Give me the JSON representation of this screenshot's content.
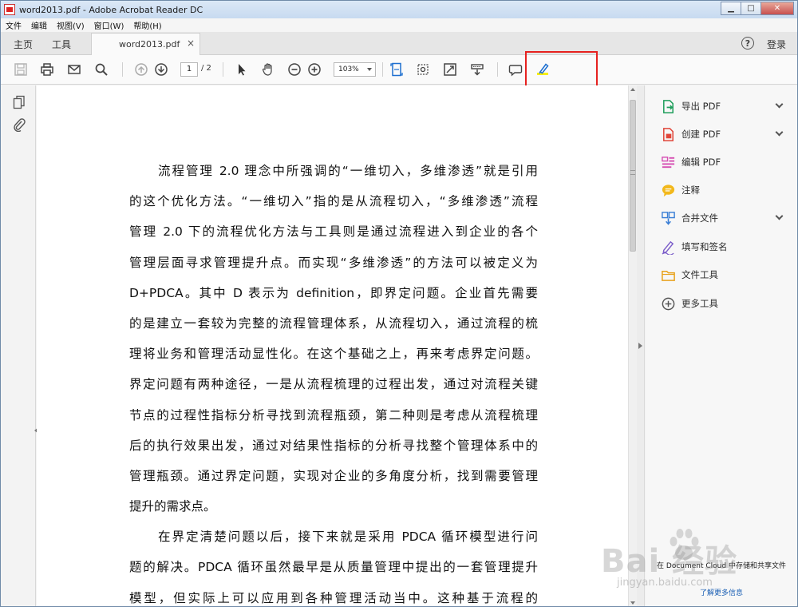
{
  "window": {
    "title": "word2013.pdf - Adobe Acrobat Reader DC",
    "minimize": "▁",
    "maximize": "□",
    "close": "✕"
  },
  "menubar": [
    "文件",
    "编辑",
    "视图(V)",
    "窗口(W)",
    "帮助(H)"
  ],
  "tabs": {
    "home": "主页",
    "tools": "工具",
    "document": "word2013.pdf",
    "close": "×",
    "help": "?",
    "login": "登录"
  },
  "toolbar": {
    "current_page": "1",
    "total_pages": "/ 2",
    "zoom": "103%"
  },
  "document": {
    "lines": [
      "流程管理 2.0 理念中所强调的“一维切入，多维渗透”就是引用",
      "的这个优化方法。“一维切入”指的是从流程切入，“多维渗透”流程",
      "管理 2.0 下的流程优化方法与工具则是通过流程进入到企业的各个",
      "管理层面寻求管理提升点。而实现“多维渗透”的方法可以被定义为",
      "D+PDCA。其中 D 表示为 definition，即界定问题。企业首先需要",
      "的是建立一套较为完整的流程管理体系，从流程切入，通过流程的梳",
      "理将业务和管理活动显性化。在这个基础之上，再来考虑界定问题。",
      "界定问题有两种途径，一是从流程梳理的过程出发，通过对流程关键",
      "节点的过程性指标分析寻找到流程瓶颈，第二种则是考虑从流程梳理",
      "后的执行效果出发，通过对结果性指标的分析寻找整个管理体系中的",
      "管理瓶颈。通过界定问题，实现对企业的多角度分析，找到需要管理",
      "提升的需求点。",
      "在界定清楚问题以后，接下来就是采用 PDCA 循环模型进行问",
      "题的解决。PDCA 循环虽然最早是从质量管理中提出的一套管理提升",
      "模型，但实际上可以应用到各种管理活动当中。这种基于流程的"
    ]
  },
  "right_panel": {
    "items": [
      {
        "label": "导出 PDF",
        "color": "#1f9e5c"
      },
      {
        "label": "创建 PDF",
        "color": "#e0463a"
      },
      {
        "label": "编辑 PDF",
        "color": "#d64fb3"
      },
      {
        "label": "注释",
        "color": "#f2b81c"
      },
      {
        "label": "合并文件",
        "color": "#3a7fd6"
      },
      {
        "label": "填写和签名",
        "color": "#7a5cc9"
      },
      {
        "label": "文件工具",
        "color": "#e8a21c"
      },
      {
        "label": "更多工具",
        "color": "#555555"
      }
    ],
    "promo": "在 Document Cloud 中存储和共享文件",
    "promo_link": "了解更多信息"
  },
  "watermark": {
    "main": "Bai 经验",
    "sub": "jingyan.baidu.com"
  },
  "colors": {
    "accent_blue": "#1a5fb4",
    "highlight_red": "#e6211f"
  }
}
